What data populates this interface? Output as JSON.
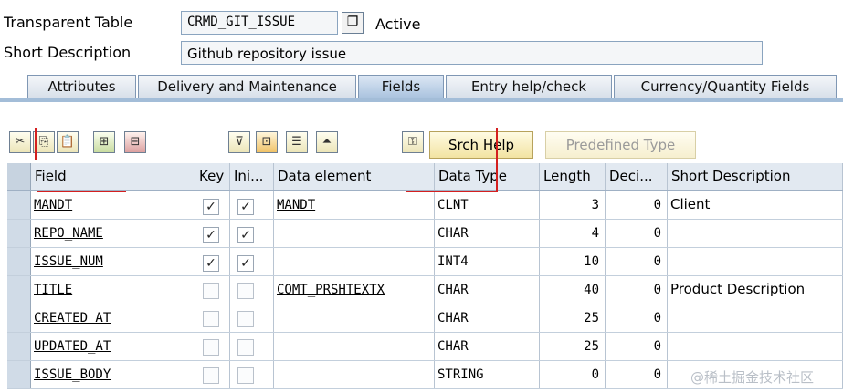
{
  "header": {
    "table_label": "Transparent Table",
    "table_name": "CRMD_GIT_ISSUE",
    "status": "Active",
    "desc_label": "Short Description",
    "description": "Github repository issue"
  },
  "tabs": [
    {
      "label": "Attributes",
      "active": false
    },
    {
      "label": "Delivery and Maintenance",
      "active": false
    },
    {
      "label": "Fields",
      "active": true
    },
    {
      "label": "Entry help/check",
      "active": false
    },
    {
      "label": "Currency/Quantity Fields",
      "active": false
    }
  ],
  "toolbar": {
    "icons": [
      "cut-icon",
      "copy-icon",
      "paste-icon",
      "insert-row-icon",
      "delete-row-icon",
      "filter-icon",
      "insert-structure-icon",
      "table-edit-icon",
      "collapse-icon",
      "search-help-key-icon"
    ],
    "srch_help": "Srch Help",
    "predefined_type": "Predefined Type"
  },
  "grid": {
    "columns": [
      "Field",
      "Key",
      "Ini...",
      "Data element",
      "Data Type",
      "Length",
      "Deci...",
      "Short Description"
    ],
    "rows": [
      {
        "field": "MANDT",
        "key": true,
        "init": true,
        "element": "MANDT",
        "type": "CLNT",
        "length": "3",
        "decimals": "0",
        "desc": "Client"
      },
      {
        "field": "REPO_NAME",
        "key": true,
        "init": true,
        "element": "",
        "type": "CHAR",
        "length": "4",
        "decimals": "0",
        "desc": ""
      },
      {
        "field": "ISSUE_NUM",
        "key": true,
        "init": true,
        "element": "",
        "type": "INT4",
        "length": "10",
        "decimals": "0",
        "desc": ""
      },
      {
        "field": "TITLE",
        "key": false,
        "init": false,
        "element": "COMT_PRSHTEXTX",
        "type": "CHAR",
        "length": "40",
        "decimals": "0",
        "desc": "Product Description"
      },
      {
        "field": "CREATED_AT",
        "key": false,
        "init": false,
        "element": "",
        "type": "CHAR",
        "length": "25",
        "decimals": "0",
        "desc": ""
      },
      {
        "field": "UPDATED_AT",
        "key": false,
        "init": false,
        "element": "",
        "type": "CHAR",
        "length": "25",
        "decimals": "0",
        "desc": ""
      },
      {
        "field": "ISSUE_BODY",
        "key": false,
        "init": false,
        "element": "",
        "type": "STRING",
        "length": "0",
        "decimals": "0",
        "desc": ""
      }
    ]
  },
  "watermark": "@稀土掘金技术社区",
  "colors": {
    "annotation_red": "#d41f1f",
    "tab_active": "#a9c2de",
    "grid_header": "#e2e9f1"
  }
}
